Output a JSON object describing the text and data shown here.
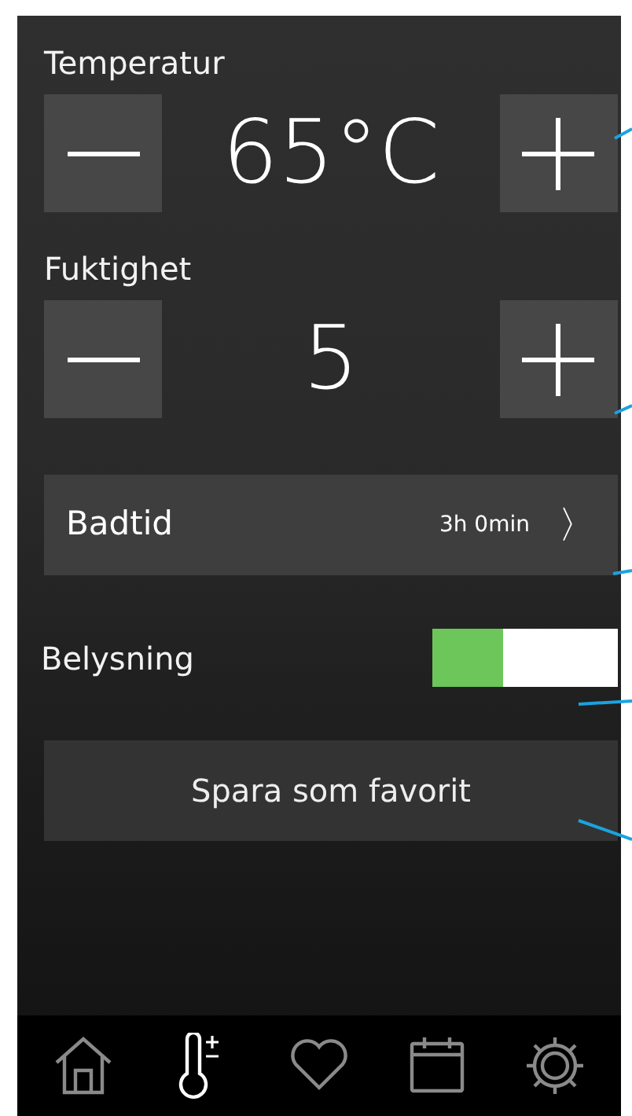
{
  "steppers": [
    {
      "label": "Temperatur",
      "value": "65°C"
    },
    {
      "label": "Fuktighet",
      "value": "5"
    }
  ],
  "bath_time": {
    "label": "Badtid",
    "value": "3h 0min",
    "chevron": "〉"
  },
  "lighting": {
    "label": "Belysning",
    "on": true
  },
  "save_button": {
    "label": "Spara som favorit"
  },
  "nav": [
    {
      "kind": "home",
      "selected": false
    },
    {
      "kind": "thermometer",
      "selected": true
    },
    {
      "kind": "heart",
      "selected": false
    },
    {
      "kind": "calendar",
      "selected": false
    },
    {
      "kind": "gear",
      "selected": false
    }
  ]
}
